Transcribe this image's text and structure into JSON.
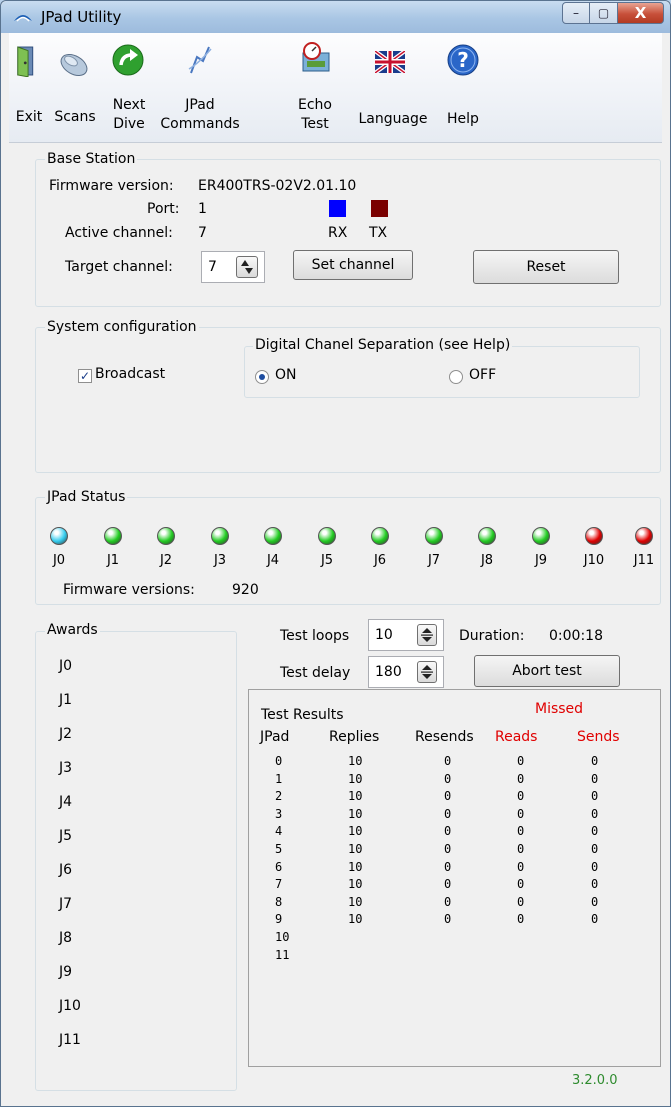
{
  "window": {
    "title": "JPad Utility",
    "minimize_glyph": "–",
    "maximize_glyph": "▢",
    "close_glyph": "X"
  },
  "toolbar": {
    "exit": "Exit",
    "scans": "Scans",
    "next_dive_1": "Next",
    "next_dive_2": "Dive",
    "jpad_commands_1": "JPad",
    "jpad_commands_2": "Commands",
    "echo_test_1": "Echo",
    "echo_test_2": "Test",
    "language": "Language",
    "help": "Help",
    "icons": [
      "door-icon",
      "scanner-icon",
      "next-arrow-icon",
      "jpad-commands-icon",
      "echo-test-icon",
      "uk-flag-icon",
      "help-icon"
    ]
  },
  "base_station": {
    "title": "Base Station",
    "firmware_label": "Firmware version:",
    "firmware_value": "ER400TRS-02V2.01.10",
    "port_label": "Port:",
    "port_value": "1",
    "active_channel_label": "Active channel:",
    "active_channel_value": "7",
    "target_channel_label": "Target channel:",
    "target_channel_value": "7",
    "rx_label": "RX",
    "tx_label": "TX",
    "rx_color": "#0000ff",
    "tx_color": "#7a0000",
    "set_channel_label": "Set channel",
    "reset_label": "Reset"
  },
  "system_config": {
    "title": "System configuration",
    "broadcast_label": "Broadcast",
    "broadcast_checked": true,
    "separation_title": "Digital Chanel Separation (see Help)",
    "on_label": "ON",
    "off_label": "OFF",
    "selected": "ON"
  },
  "jpad_status": {
    "title": "JPad Status",
    "pads": [
      {
        "label": "J0",
        "color": "#33ccee"
      },
      {
        "label": "J1",
        "color": "#22cc22"
      },
      {
        "label": "J2",
        "color": "#22cc22"
      },
      {
        "label": "J3",
        "color": "#22cc22"
      },
      {
        "label": "J4",
        "color": "#22cc22"
      },
      {
        "label": "J5",
        "color": "#22cc22"
      },
      {
        "label": "J6",
        "color": "#22cc22"
      },
      {
        "label": "J7",
        "color": "#22cc22"
      },
      {
        "label": "J8",
        "color": "#22cc22"
      },
      {
        "label": "J9",
        "color": "#22cc22"
      },
      {
        "label": "J10",
        "color": "#e00000"
      },
      {
        "label": "J11",
        "color": "#e00000"
      }
    ],
    "firmware_versions_label": "Firmware versions:",
    "firmware_versions_value": "920"
  },
  "awards": {
    "title": "Awards",
    "items": [
      "J0",
      "J1",
      "J2",
      "J3",
      "J4",
      "J5",
      "J6",
      "J7",
      "J8",
      "J9",
      "J10",
      "J11"
    ]
  },
  "test": {
    "loops_label": "Test loops",
    "loops_value": "10",
    "delay_label": "Test delay",
    "delay_value": "180",
    "duration_label": "Duration:",
    "duration_value": "0:00:18",
    "abort_label": "Abort test"
  },
  "results": {
    "title": "Test Results",
    "missed_label": "Missed",
    "missed_color": "#e00000",
    "headers": [
      "JPad",
      "Replies",
      "Resends",
      "Reads",
      "Sends"
    ],
    "rows": [
      [
        "0",
        "10",
        "0",
        "0",
        "0"
      ],
      [
        "1",
        "10",
        "0",
        "0",
        "0"
      ],
      [
        "2",
        "10",
        "0",
        "0",
        "0"
      ],
      [
        "3",
        "10",
        "0",
        "0",
        "0"
      ],
      [
        "4",
        "10",
        "0",
        "0",
        "0"
      ],
      [
        "5",
        "10",
        "0",
        "0",
        "0"
      ],
      [
        "6",
        "10",
        "0",
        "0",
        "0"
      ],
      [
        "7",
        "10",
        "0",
        "0",
        "0"
      ],
      [
        "8",
        "10",
        "0",
        "0",
        "0"
      ],
      [
        "9",
        "10",
        "0",
        "0",
        "0"
      ],
      [
        "10",
        "",
        "",
        "",
        ""
      ],
      [
        "11",
        "",
        "",
        "",
        ""
      ]
    ]
  },
  "version": {
    "label": "3.2.0.0",
    "color": "#2e8b2e"
  }
}
